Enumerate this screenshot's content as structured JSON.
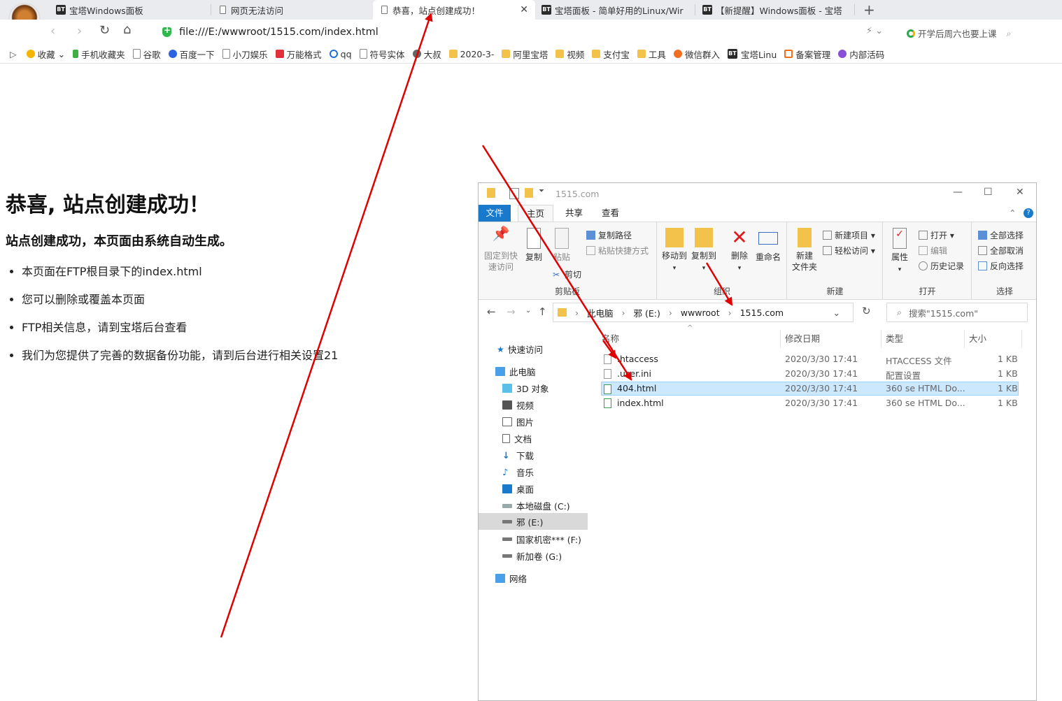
{
  "browser": {
    "tabs": [
      {
        "label": "宝塔Windows面板",
        "icon": "bt-icon"
      },
      {
        "label": "网页无法访问",
        "icon": "page-icon"
      },
      {
        "label": "恭喜，站点创建成功！",
        "icon": "page-icon",
        "active": true
      },
      {
        "label": "宝塔面板 - 简单好用的Linux/Wir",
        "icon": "bt-icon"
      },
      {
        "label": "【新提醒】Windows面板 - 宝塔",
        "icon": "bt-icon"
      }
    ],
    "url": "file:///E:/wwwroot/1515.com/index.html",
    "search_hint": "开学后周六也要上课",
    "bookmarks": [
      "收藏",
      "手机收藏夹",
      "谷歌",
      "百度一下",
      "小刀娱乐",
      "万能格式",
      "qq",
      "符号实体",
      "大叔",
      "2020-3-",
      "阿里宝塔",
      "视频",
      "支付宝",
      "工具",
      "微信群入",
      "宝塔Linu",
      "备案管理",
      "内部活码"
    ]
  },
  "page": {
    "heading": "恭喜, 站点创建成功！",
    "subheading": "站点创建成功，本页面由系统自动生成。",
    "items": [
      "本页面在FTP根目录下的index.html",
      "您可以删除或覆盖本页面",
      "FTP相关信息，请到宝塔后台查看",
      "我们为您提供了完善的数据备份功能，请到后台进行相关设置21"
    ]
  },
  "explorer": {
    "title": "1515.com",
    "ribbon_tabs": [
      "文件",
      "主页",
      "共享",
      "查看"
    ],
    "ribbon": {
      "pin": "固定到快\n速访问",
      "copy": "复制",
      "paste": "粘贴",
      "copy_path": "复制路径",
      "paste_shortcut": "粘贴快捷方式",
      "cut": "剪切",
      "clipboard": "剪贴板",
      "move_to": "移动到",
      "copy_to": "复制到",
      "delete": "删除",
      "rename": "重命名",
      "organize": "组织",
      "new_folder": "新建\n文件夹",
      "new_item": "新建项目",
      "easy_access": "轻松访问",
      "new_group": "新建",
      "properties": "属性",
      "open": "打开",
      "edit": "编辑",
      "history": "历史记录",
      "open_group": "打开",
      "select_all": "全部选择",
      "select_none": "全部取消",
      "invert": "反向选择",
      "select_group": "选择"
    },
    "path": [
      "此电脑",
      "邪 (E:)",
      "wwwroot",
      "1515.com"
    ],
    "search_placeholder": "搜索\"1515.com\"",
    "nav": [
      {
        "label": "快速访问",
        "icon": "star-icon"
      },
      {
        "label": "此电脑",
        "icon": "computer-icon"
      },
      {
        "label": "3D 对象",
        "icon": "cube-icon"
      },
      {
        "label": "视频",
        "icon": "video-icon"
      },
      {
        "label": "图片",
        "icon": "picture-icon"
      },
      {
        "label": "文档",
        "icon": "document-icon"
      },
      {
        "label": "下载",
        "icon": "download-icon"
      },
      {
        "label": "音乐",
        "icon": "music-icon"
      },
      {
        "label": "桌面",
        "icon": "desktop-icon"
      },
      {
        "label": "本地磁盘 (C:)",
        "icon": "drive-icon"
      },
      {
        "label": "邪 (E:)",
        "icon": "drive-icon"
      },
      {
        "label": "国家机密*** (F:)",
        "icon": "drive-icon"
      },
      {
        "label": "新加卷 (G:)",
        "icon": "drive-icon"
      },
      {
        "label": "网络",
        "icon": "network-icon"
      }
    ],
    "columns": [
      "名称",
      "修改日期",
      "类型",
      "大小"
    ],
    "files": [
      {
        "name": ".htaccess",
        "date": "2020/3/30 17:41",
        "type": "HTACCESS 文件",
        "size": "1 KB"
      },
      {
        "name": ".user.ini",
        "date": "2020/3/30 17:41",
        "type": "配置设置",
        "size": "1 KB"
      },
      {
        "name": "404.html",
        "date": "2020/3/30 17:41",
        "type": "360 se HTML Do...",
        "size": "1 KB"
      },
      {
        "name": "index.html",
        "date": "2020/3/30 17:41",
        "type": "360 se HTML Do...",
        "size": "1 KB"
      }
    ]
  },
  "colors": {
    "annotation_arrow": "#e00000",
    "ribbon_file_tab": "#1979ca",
    "selection": "#cce8ff"
  }
}
